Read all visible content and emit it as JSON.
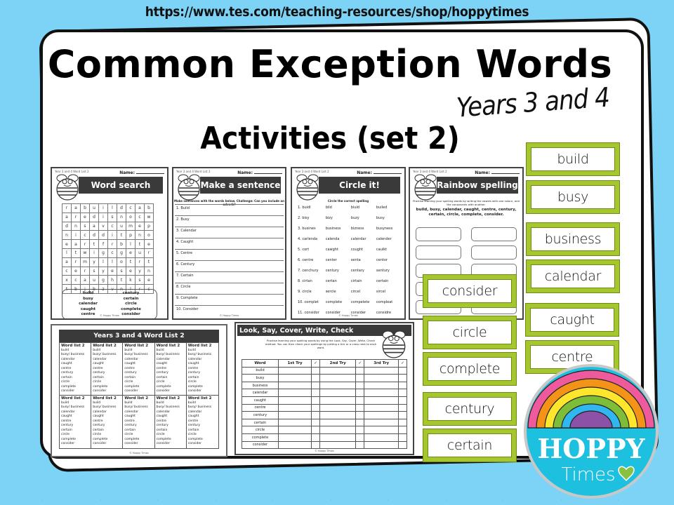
{
  "header": {
    "url": "https://www.tes.com/teaching-resources/shop/hoppytimes",
    "title": "Common Exception Words",
    "years": "Years 3 and 4",
    "subtitle": "Activities (set 2)"
  },
  "colors": {
    "background": "#12b9ec",
    "dots": "#7dd3f5",
    "card_border": "#a5c62c",
    "banner": "#3a3a3a"
  },
  "sheets": {
    "common": {
      "name_label": "Name:",
      "small_header": "Year 3 and 4 Word List 2",
      "footer": "© Hoppy Times"
    },
    "word_search": {
      "title": "Word search",
      "grid": [
        [
          "r",
          "a",
          "b",
          "u",
          "i",
          "l",
          "d",
          "c",
          "a",
          "b"
        ],
        [
          "a",
          "r",
          "e",
          "d",
          "i",
          "s",
          "n",
          "o",
          "c",
          "w"
        ],
        [
          "d",
          "n",
          "s",
          "a",
          "v",
          "c",
          "u",
          "m",
          "e",
          "p"
        ],
        [
          "n",
          "i",
          "c",
          "d",
          "d",
          "i",
          "t",
          "p",
          "n",
          "o"
        ],
        [
          "e",
          "a",
          "r",
          "t",
          "f",
          "r",
          "b",
          "l",
          "t",
          "e"
        ],
        [
          "l",
          "t",
          "w",
          "i",
          "g",
          "c",
          "g",
          "e",
          "u",
          "r"
        ],
        [
          "a",
          "r",
          "m",
          "y",
          "l",
          "l",
          "o",
          "t",
          "r",
          "t"
        ],
        [
          "c",
          "e",
          "r",
          "s",
          "y",
          "e",
          "s",
          "e",
          "y",
          "n"
        ],
        [
          "x",
          "c",
          "a",
          "u",
          "g",
          "h",
          "t",
          "k",
          "s",
          "e"
        ],
        [
          "t",
          "b",
          "j",
          "b",
          "z",
          "v",
          "n",
          "l",
          "r",
          "c"
        ]
      ],
      "words": [
        "build",
        "century",
        "busy",
        "certain",
        "calendar",
        "circle",
        "caught",
        "complete",
        "centre",
        "consider"
      ]
    },
    "make_sentence": {
      "title": "Make a sentence",
      "instruction": "Make sentences with the words below. Challenge: Can you include an adverb?",
      "lines": [
        "1. Build",
        "2. Busy",
        "3. Calendar",
        "4. Caught",
        "5. Centre",
        "6. Century",
        "7. Certain",
        "8. Circle",
        "9. Complete",
        "10. Consider"
      ]
    },
    "circle_it": {
      "title": "Circle it!",
      "instruction": "Circle the correct spelling",
      "rows": [
        [
          "1. buidl",
          "bild",
          "biuld",
          "builed"
        ],
        [
          "2. bisy",
          "bizy",
          "buzy",
          "busy"
        ],
        [
          "3. busines",
          "business",
          "bizness",
          "busyness"
        ],
        [
          "4. carlenda",
          "calenda",
          "calendar",
          "calender"
        ],
        [
          "5. cort",
          "cawght",
          "cought",
          "caulkt"
        ],
        [
          "6. centre",
          "center",
          "senta",
          "centor"
        ],
        [
          "7. cenchury",
          "century",
          "centary",
          "sentury"
        ],
        [
          "8. cirtan",
          "certan",
          "cirtain",
          "certain"
        ],
        [
          "9. circle",
          "sercle",
          "circel",
          "sircel"
        ],
        [
          "10. complet",
          "complete",
          "compelete",
          "compleat"
        ],
        [
          "11. considor",
          "consider",
          "consider",
          "considre"
        ]
      ]
    },
    "rainbow": {
      "title": "Rainbow spelling",
      "instruction": "Practise learning your spelling words by writing the vowels with one colour, and the consonants with another.",
      "words": "build, busy, calendar, caught, centre, century, certain, circle, complete, consider."
    },
    "word_list": {
      "title": "Years 3 and 4 Word List 2",
      "heading": "Word list 2",
      "words": [
        "build",
        "busy/ business",
        "calendar",
        "caught",
        "centre",
        "century",
        "certain",
        "circle",
        "complete",
        "consider"
      ]
    },
    "lscwc": {
      "title": "Look, Say, Cover, Write, Check",
      "instruction": "Practise learning your spelling words by using the Look, Say, Cover, Write, Check method. You can then check your spellings by putting a tick or a cross next to each word.",
      "columns": [
        "Word",
        "1st Try",
        "✓",
        "2nd Try",
        "✓",
        "3rd Try",
        "✓"
      ],
      "words": [
        "build",
        "busy",
        "business",
        "calendar",
        "caught",
        "centre",
        "century",
        "certain",
        "circle",
        "complete",
        "consider"
      ]
    }
  },
  "cards": [
    "build",
    "busy",
    "business",
    "calendar",
    "caught",
    "centre",
    "consider",
    "circle",
    "complete",
    "century",
    "certain"
  ],
  "logo": {
    "line1": "HOPPY",
    "line2": "Times"
  }
}
